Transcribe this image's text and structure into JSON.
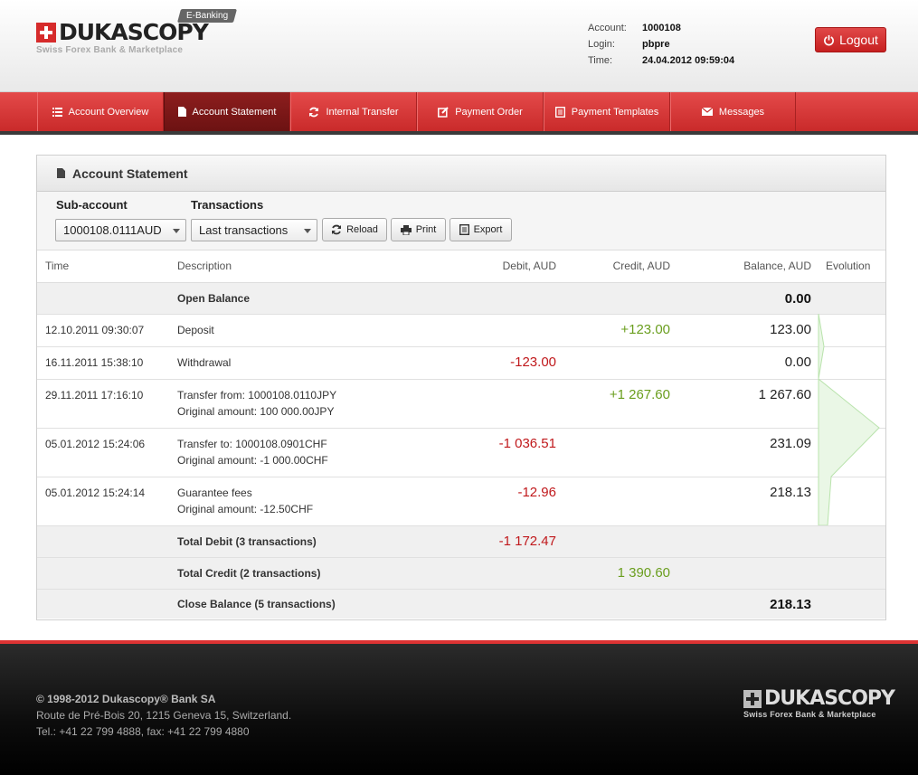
{
  "header": {
    "logo_name": "DUKASCOPY",
    "logo_tagline": "Swiss Forex Bank & Marketplace",
    "badge": "E-Banking",
    "account_label": "Account:",
    "account_value": "1000108",
    "login_label": "Login:",
    "login_value": "pbpre",
    "time_label": "Time:",
    "time_value": "24.04.2012 09:59:04",
    "logout_label": "Logout"
  },
  "nav": [
    {
      "label": "Account Overview",
      "icon": "list-icon"
    },
    {
      "label": "Account Statement",
      "icon": "document-icon",
      "active": true
    },
    {
      "label": "Internal Transfer",
      "icon": "refresh-icon"
    },
    {
      "label": "Payment Order",
      "icon": "edit-icon"
    },
    {
      "label": "Payment Templates",
      "icon": "template-icon"
    },
    {
      "label": "Messages",
      "icon": "envelope-icon"
    }
  ],
  "panel": {
    "title": "Account Statement",
    "subaccount_label": "Sub-account",
    "subaccount_value": "1000108.0111AUD",
    "transactions_label": "Transactions",
    "transactions_value": "Last transactions",
    "reload_label": "Reload",
    "print_label": "Print",
    "export_label": "Export"
  },
  "table": {
    "headers": [
      "Time",
      "Description",
      "Debit, AUD",
      "Credit, AUD",
      "Balance, AUD",
      "Evolution"
    ],
    "open_balance": {
      "label": "Open Balance",
      "balance": "0.00"
    },
    "rows": [
      {
        "time": "12.10.2011 09:30:07",
        "desc1": "Deposit",
        "desc2": "",
        "debit": "",
        "credit": "+123.00",
        "balance": "123.00"
      },
      {
        "time": "16.11.2011 15:38:10",
        "desc1": "Withdrawal",
        "desc2": "",
        "debit": "-123.00",
        "credit": "",
        "balance": "0.00"
      },
      {
        "time": "29.11.2011 17:16:10",
        "desc1": "Transfer from: 1000108.0110JPY",
        "desc2": "Original amount: 100 000.00JPY",
        "debit": "",
        "credit": "+1 267.60",
        "balance": "1 267.60"
      },
      {
        "time": "05.01.2012 15:24:06",
        "desc1": "Transfer to: 1000108.0901CHF",
        "desc2": "Original amount: -1 000.00CHF",
        "debit": "-1 036.51",
        "credit": "",
        "balance": "231.09"
      },
      {
        "time": "05.01.2012 15:24:14",
        "desc1": "Guarantee fees",
        "desc2": "Original amount: -12.50CHF",
        "debit": "-12.96",
        "credit": "",
        "balance": "218.13"
      }
    ],
    "total_debit": {
      "label": "Total Debit (3 transactions)",
      "value": "-1 172.47"
    },
    "total_credit": {
      "label": "Total Credit (2 transactions)",
      "value": "1 390.60"
    },
    "close_balance": {
      "label": "Close Balance (5 transactions)",
      "value": "218.13"
    }
  },
  "footer": {
    "copyright": "© 1998-2012 Dukascopy® Bank SA",
    "address": "Route de Pré-Bois 20, 1215 Geneva 15, Switzerland.",
    "phone": "Tel.: +41 22 799 4888, fax: +41 22 799 4880",
    "logo_name": "DUKASCOPY",
    "logo_tagline": "Swiss Forex Bank & Marketplace"
  }
}
